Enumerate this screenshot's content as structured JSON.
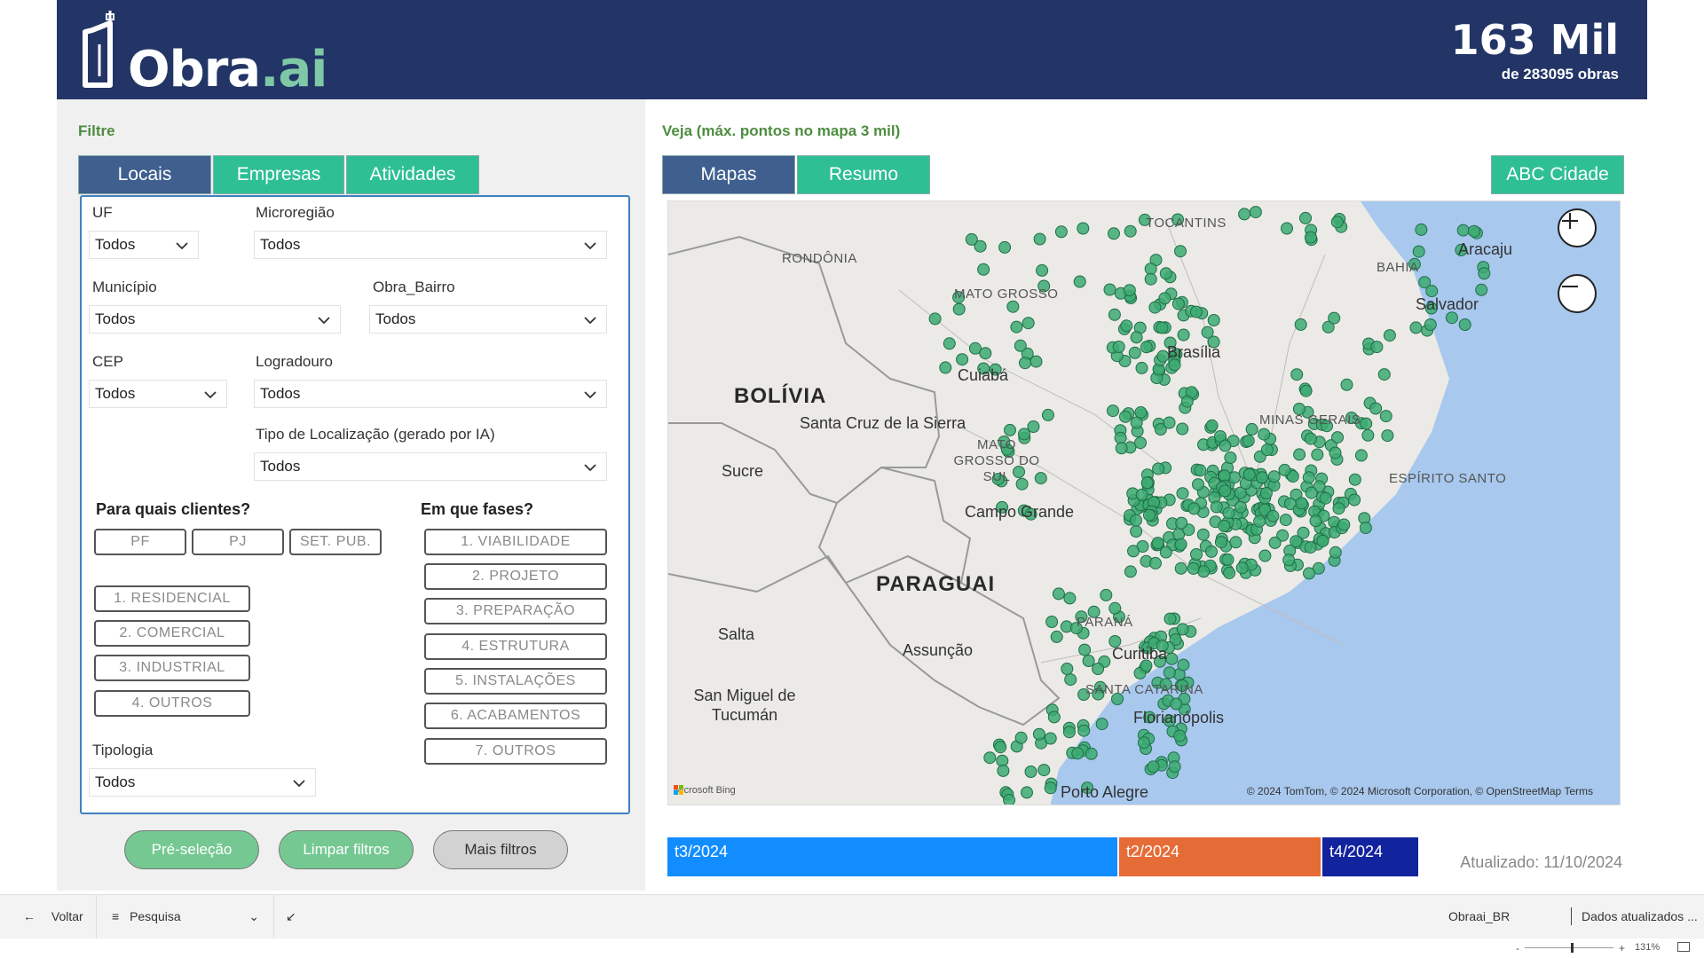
{
  "header": {
    "logo_text_main": "Obra",
    "logo_text_suffix": ".ai",
    "count_value": "163 Mil",
    "count_sub": "de 283095 obras"
  },
  "filter": {
    "title": "Filtre",
    "tabs": [
      "Locais",
      "Empresas",
      "Atividades"
    ],
    "uf_label": "UF",
    "uf_value": "Todos",
    "microregiao_label": "Microregião",
    "microregiao_value": "Todos",
    "municipio_label": "Município",
    "municipio_value": "Todos",
    "bairro_label": "Obra_Bairro",
    "bairro_value": "Todos",
    "cep_label": "CEP",
    "cep_value": "Todos",
    "logradouro_label": "Logradouro",
    "logradouro_value": "Todos",
    "tipo_label": "Tipo de Localização (gerado por IA)",
    "tipo_value": "Todos",
    "clientes_label": "Para quais clientes?",
    "clientes": [
      "PF",
      "PJ",
      "SET. PUB."
    ],
    "categorias": [
      "1. RESIDENCIAL",
      "2. COMERCIAL",
      "3. INDUSTRIAL",
      "4. OUTROS"
    ],
    "fases_label": "Em que fases?",
    "fases": [
      "1. VIABILIDADE",
      "2. PROJETO",
      "3. PREPARAÇÃO",
      "4. ESTRUTURA",
      "5. INSTALAÇÕES",
      "6. ACABAMENTOS",
      "7. OUTROS"
    ],
    "tipologia_label": "Tipologia",
    "tipologia_value": "Todos",
    "buttons": {
      "preselecao": "Pré-seleção",
      "limpar": "Limpar filtros",
      "mais": "Mais filtros"
    }
  },
  "view": {
    "title": "Veja (máx. pontos no mapa 3 mil)",
    "tabs": [
      "Mapas",
      "Resumo"
    ],
    "abc_button": "ABC Cidade"
  },
  "map": {
    "countries": [
      "BOLÍVIA",
      "PARAGUAI"
    ],
    "cities": [
      "Cuiabá",
      "Santa Cruz de la Sierra",
      "Sucre",
      "Campo Grande",
      "Salta",
      "Assunção",
      "San Miguel de Tucumán",
      "Curitiba",
      "Florianópolis",
      "Porto Alegre",
      "Salvador",
      "Aracaju",
      "Brasília"
    ],
    "states": [
      "RONDÔNIA",
      "MATO GROSSO",
      "TOCANTINS",
      "BAHIA",
      "MINAS GERAIS",
      "MATO GROSSO DO SUL",
      "ESPÍRITO SANTO",
      "PARANÁ",
      "SANTA CATARINA"
    ],
    "attribution": "© 2024 TomTom, © 2024 Microsoft Corporation, © OpenStreetMap  Terms",
    "provider": "Microsoft Bing",
    "point_color": "#3daa72"
  },
  "periods": {
    "items": [
      "t3/2024",
      "t2/2024",
      "t4/2024"
    ],
    "colors": [
      "#118dff",
      "#e66c37",
      "#12239e"
    ],
    "shares": [
      0.6,
      0.27,
      0.13
    ]
  },
  "updated": "Atualizado: 11/10/2024",
  "statusbar": {
    "back": "Voltar",
    "search": "Pesquisa",
    "report": "Obraai_BR",
    "data_status": "Dados atualizados ...",
    "zoom": "131%"
  }
}
